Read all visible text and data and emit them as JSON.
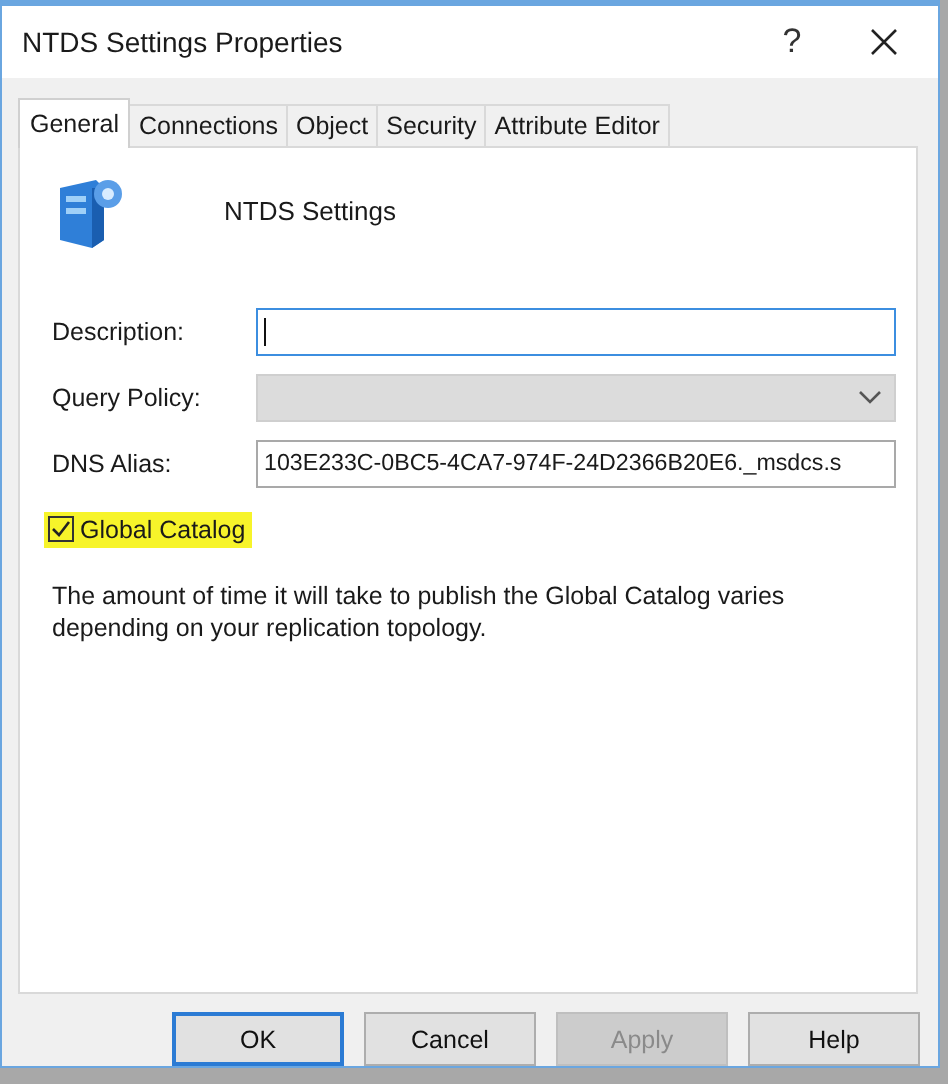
{
  "window": {
    "title": "NTDS Settings Properties",
    "help_button": "?"
  },
  "tabs": [
    {
      "label": "General",
      "selected": true
    },
    {
      "label": "Connections",
      "selected": false
    },
    {
      "label": "Object",
      "selected": false
    },
    {
      "label": "Security",
      "selected": false
    },
    {
      "label": "Attribute Editor",
      "selected": false
    }
  ],
  "header": {
    "name": "NTDS Settings"
  },
  "fields": [
    {
      "kind": "text",
      "label": "Description:",
      "focused": true,
      "disabled": false
    },
    {
      "kind": "dropdown",
      "label": "Query Policy:",
      "focused": false,
      "disabled": true
    },
    {
      "kind": "text",
      "label": "DNS Alias:",
      "value": "103E233C-0BC5-4CA7-974F-24D2366B20E6._msdcs.s",
      "focused": false,
      "disabled": false
    }
  ],
  "checkbox": {
    "label": "Global Catalog",
    "checked": true,
    "highlighted": true
  },
  "note": "The amount of time it will take to publish the Global Catalog varies depending on your replication topology.",
  "buttons": [
    {
      "label": "OK",
      "default": true,
      "disabled": false
    },
    {
      "label": "Cancel",
      "default": false,
      "disabled": false
    },
    {
      "label": "Apply",
      "default": false,
      "disabled": true
    },
    {
      "label": "Help",
      "default": false,
      "disabled": false
    }
  ]
}
